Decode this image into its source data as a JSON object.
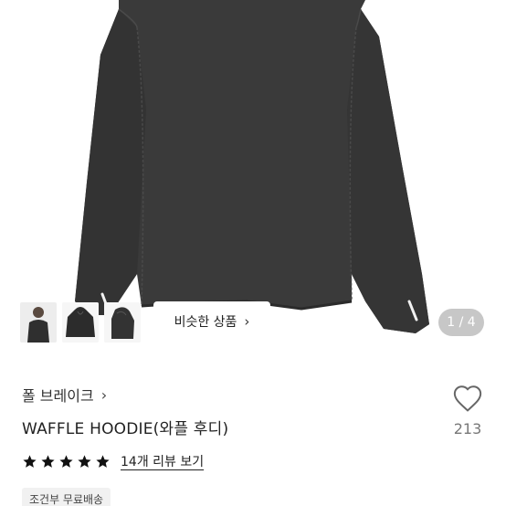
{
  "gallery": {
    "similar_button_label": "비슷한 상품",
    "page_indicator": "1 / 4",
    "thumbnails": [
      {
        "name": "thumbnail-model-photo"
      },
      {
        "name": "thumbnail-hoodie-front"
      },
      {
        "name": "thumbnail-hoodie-side"
      }
    ]
  },
  "product": {
    "brand": "폴 브레이크",
    "title": "WAFFLE HOODIE(와플 후디)",
    "rating_stars": 5,
    "review_link": "14개 리뷰 보기",
    "shipping_badge": "조건부 무료배송",
    "like_count": "213"
  },
  "icons": {
    "like": "heart-outline-icon",
    "star": "star-filled-icon",
    "chevron": "chevron-right-icon"
  },
  "colors": {
    "garment": "#3b3b3b",
    "star": "#111111",
    "counter_bg": "#8a8a8a"
  }
}
